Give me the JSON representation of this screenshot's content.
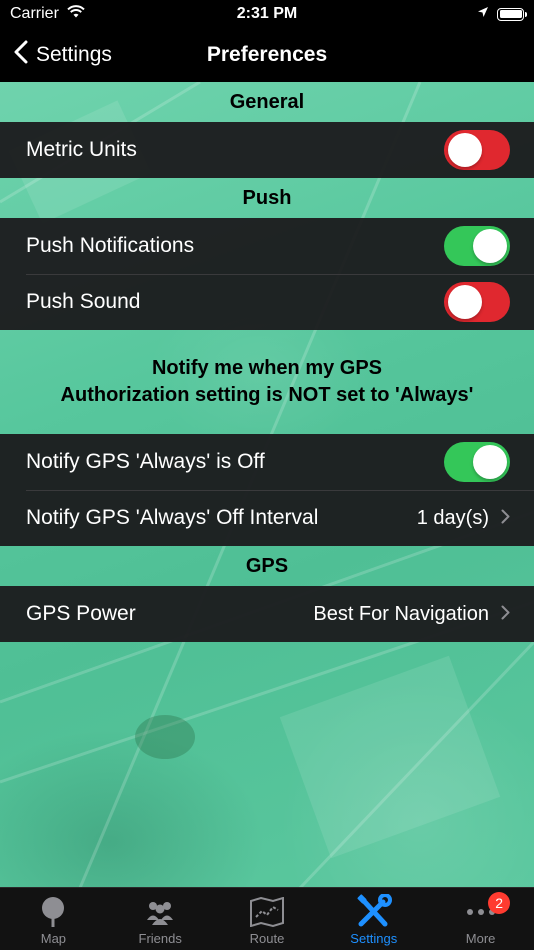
{
  "status_bar": {
    "carrier": "Carrier",
    "time": "2:31 PM"
  },
  "nav": {
    "back_label": "Settings",
    "title": "Preferences"
  },
  "sections": {
    "general": {
      "header": "General",
      "metric_units": {
        "label": "Metric Units",
        "on": false
      }
    },
    "push": {
      "header": "Push",
      "notifications": {
        "label": "Push Notifications",
        "on": true
      },
      "sound": {
        "label": "Push Sound",
        "on": false
      }
    },
    "gps_notice": {
      "line1": "Notify me when my GPS",
      "line2": "Authorization setting is NOT set to 'Always'",
      "always_off": {
        "label": "Notify GPS 'Always' is Off",
        "on": true
      },
      "interval": {
        "label": "Notify GPS 'Always' Off Interval",
        "value": "1 day(s)"
      }
    },
    "gps": {
      "header": "GPS",
      "power": {
        "label": "GPS Power",
        "value": "Best For Navigation"
      }
    }
  },
  "tabs": [
    {
      "label": "Map",
      "icon": "map-pin-icon"
    },
    {
      "label": "Friends",
      "icon": "friends-icon"
    },
    {
      "label": "Route",
      "icon": "route-map-icon"
    },
    {
      "label": "Settings",
      "icon": "settings-tools-icon"
    },
    {
      "label": "More",
      "icon": "more-dots-icon",
      "badge": "2"
    }
  ],
  "colors": {
    "toggle_on": "#34c759",
    "toggle_off": "#e0282f",
    "tab_active": "#1e90ff",
    "background_tint": "#57c79d"
  }
}
